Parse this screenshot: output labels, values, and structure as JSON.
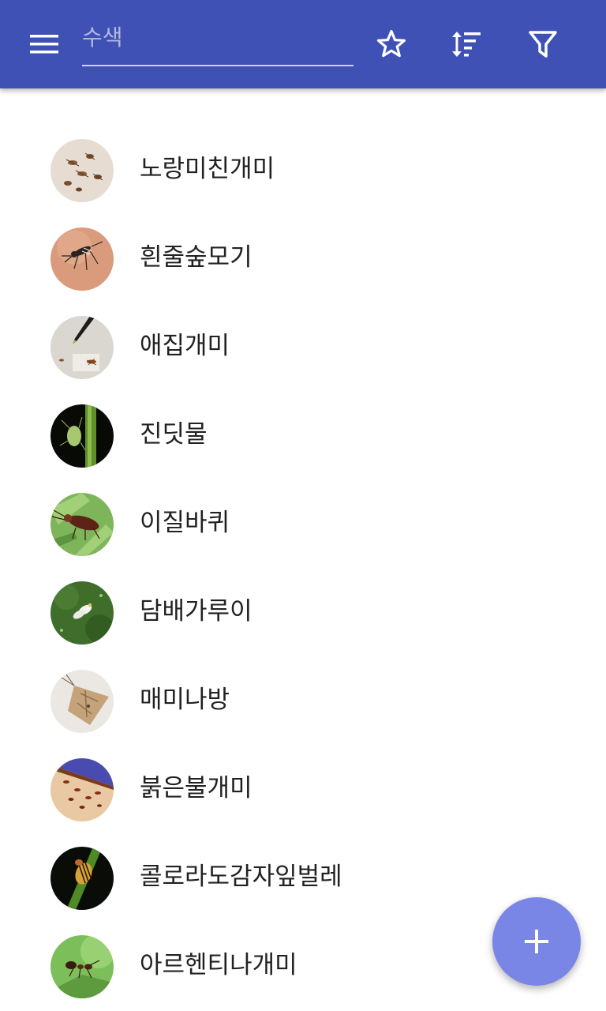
{
  "toolbar": {
    "search_placeholder": "수색",
    "menu_icon": "menu-icon",
    "favorites_icon": "star-outline-icon",
    "sort_icon": "sort-icon",
    "filter_icon": "filter-icon",
    "background_color": "#3f51b5"
  },
  "items": [
    {
      "label": "노랑미친개미",
      "thumb": "ants-photo"
    },
    {
      "label": "흰줄숲모기",
      "thumb": "mosquito-photo"
    },
    {
      "label": "애집개미",
      "thumb": "ant-with-pen-photo"
    },
    {
      "label": "진딧물",
      "thumb": "aphid-photo"
    },
    {
      "label": "이질바퀴",
      "thumb": "cockroach-photo"
    },
    {
      "label": "담배가루이",
      "thumb": "whitefly-photo"
    },
    {
      "label": "매미나방",
      "thumb": "moth-photo"
    },
    {
      "label": "붉은불개미",
      "thumb": "fire-ants-photo"
    },
    {
      "label": "콜로라도감자잎벌레",
      "thumb": "potato-beetle-photo"
    },
    {
      "label": "아르헨티나개미",
      "thumb": "argentine-ant-photo"
    }
  ],
  "fab": {
    "icon": "plus-icon",
    "color": "#7986e6"
  }
}
